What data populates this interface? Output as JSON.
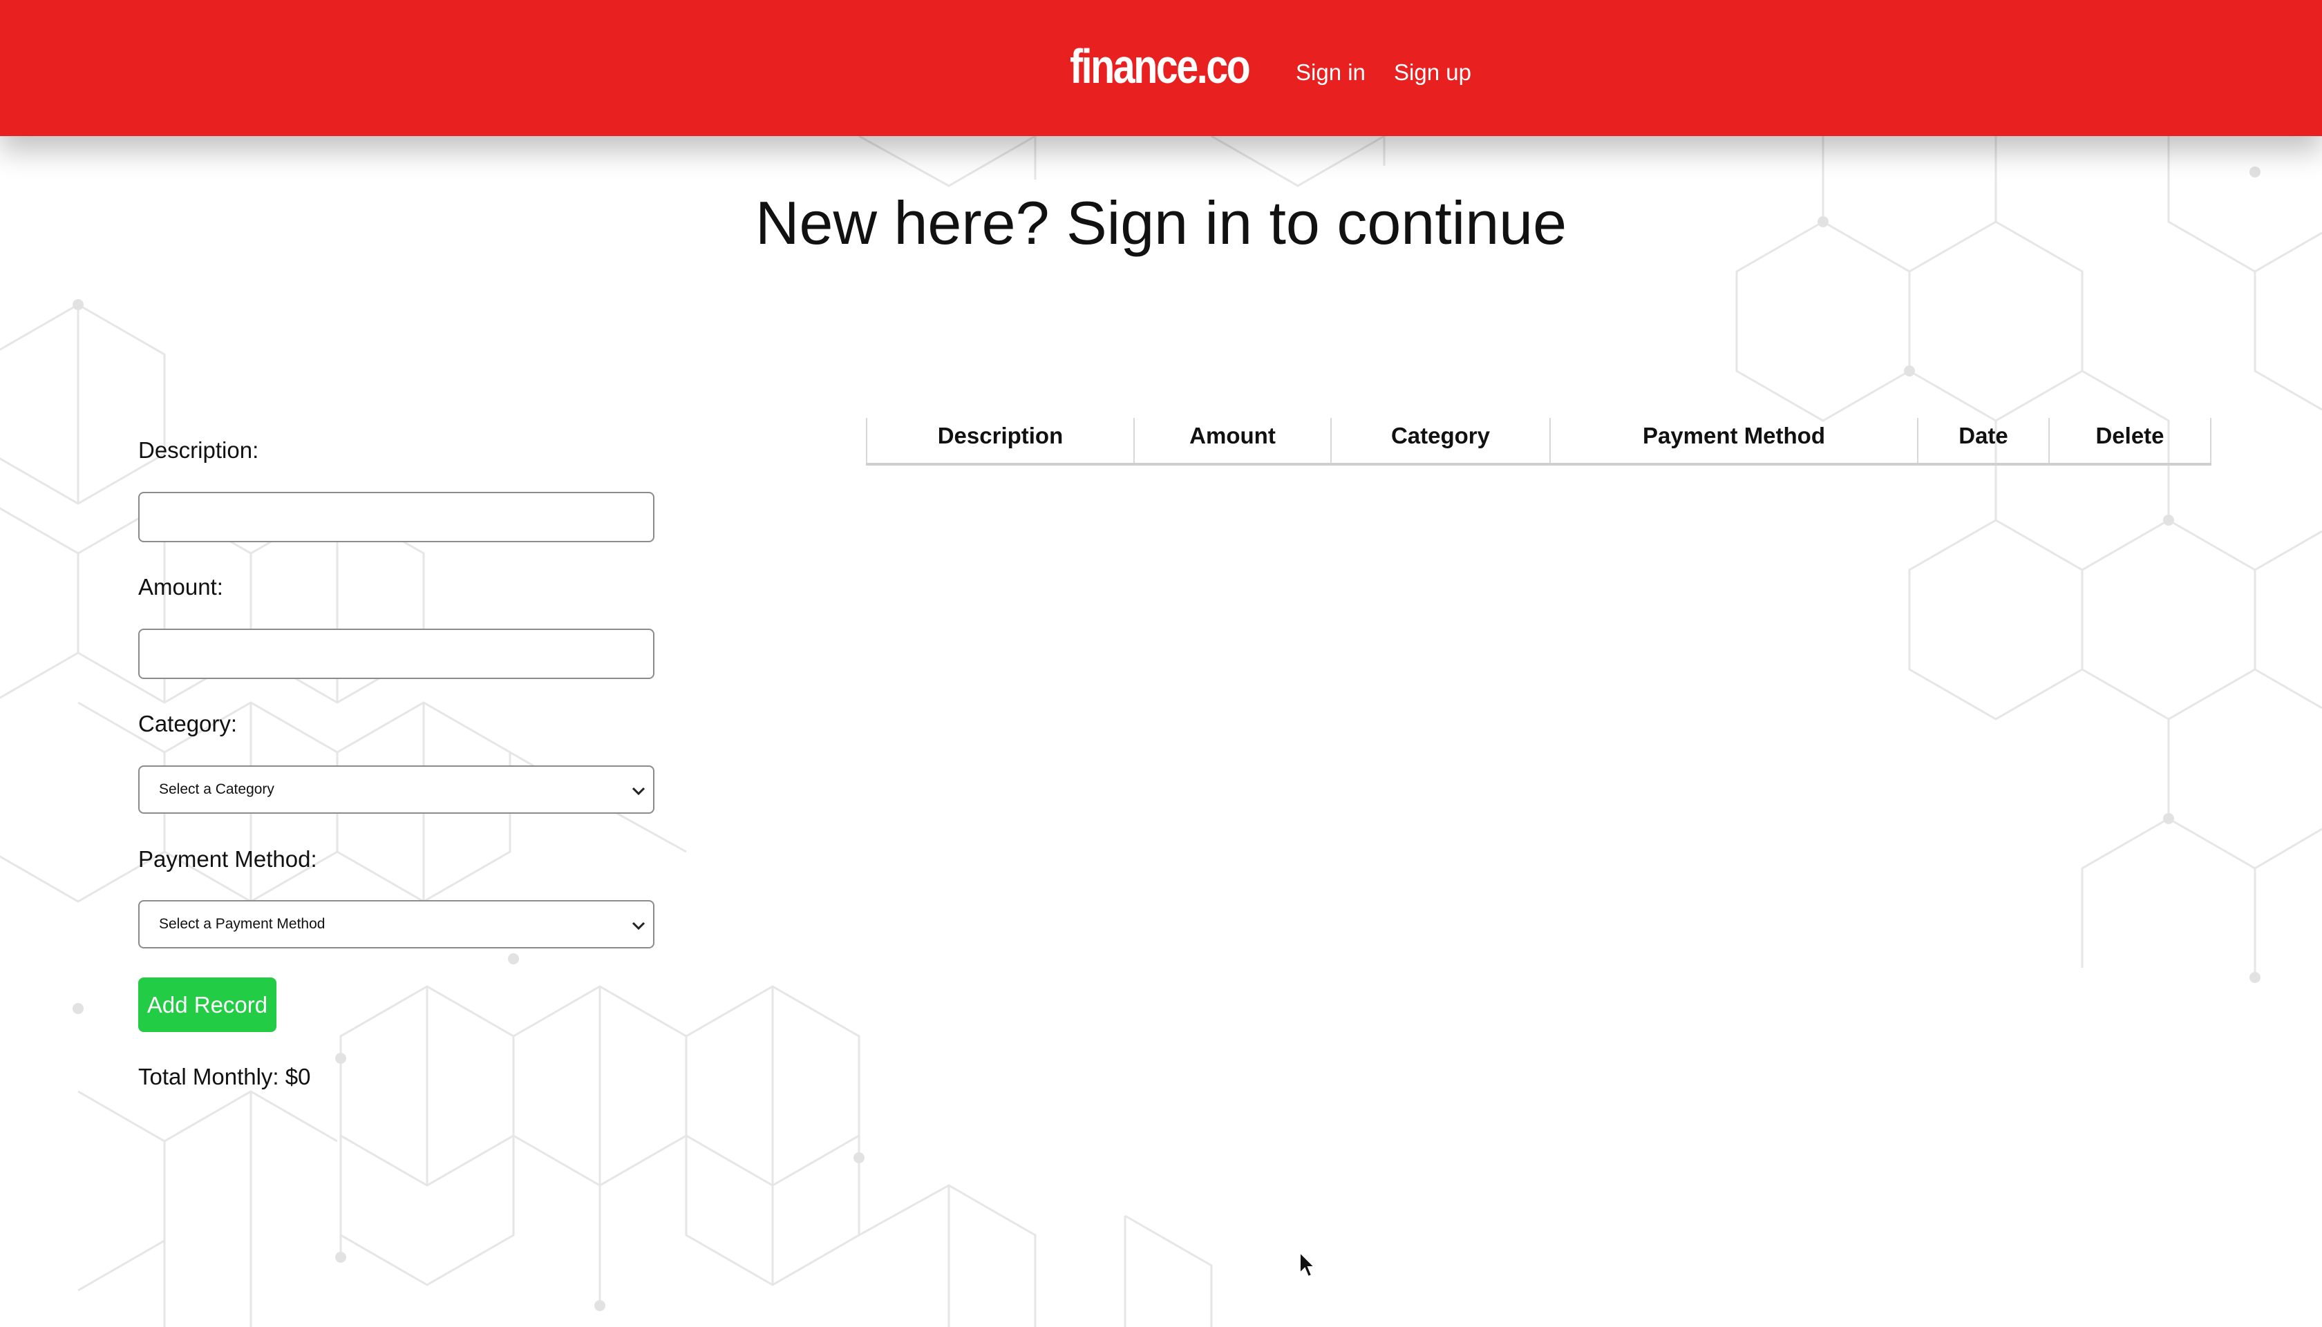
{
  "navbar": {
    "brand": "finance.co",
    "sign_in": "Sign in",
    "sign_up": "Sign up",
    "background_color": "#e8201f"
  },
  "headline": "New here? Sign in to continue",
  "form": {
    "description_label": "Description:",
    "description_value": "",
    "amount_label": "Amount:",
    "amount_value": "",
    "category_label": "Category:",
    "category_selected": "Select a Category",
    "payment_label": "Payment Method:",
    "payment_selected": "Select a Payment Method",
    "add_button": "Add Record",
    "add_button_color": "#22cc44",
    "total": "Total Monthly: $0"
  },
  "table": {
    "columns": [
      "Description",
      "Amount",
      "Category",
      "Payment Method",
      "Date",
      "Delete"
    ],
    "rows": []
  }
}
